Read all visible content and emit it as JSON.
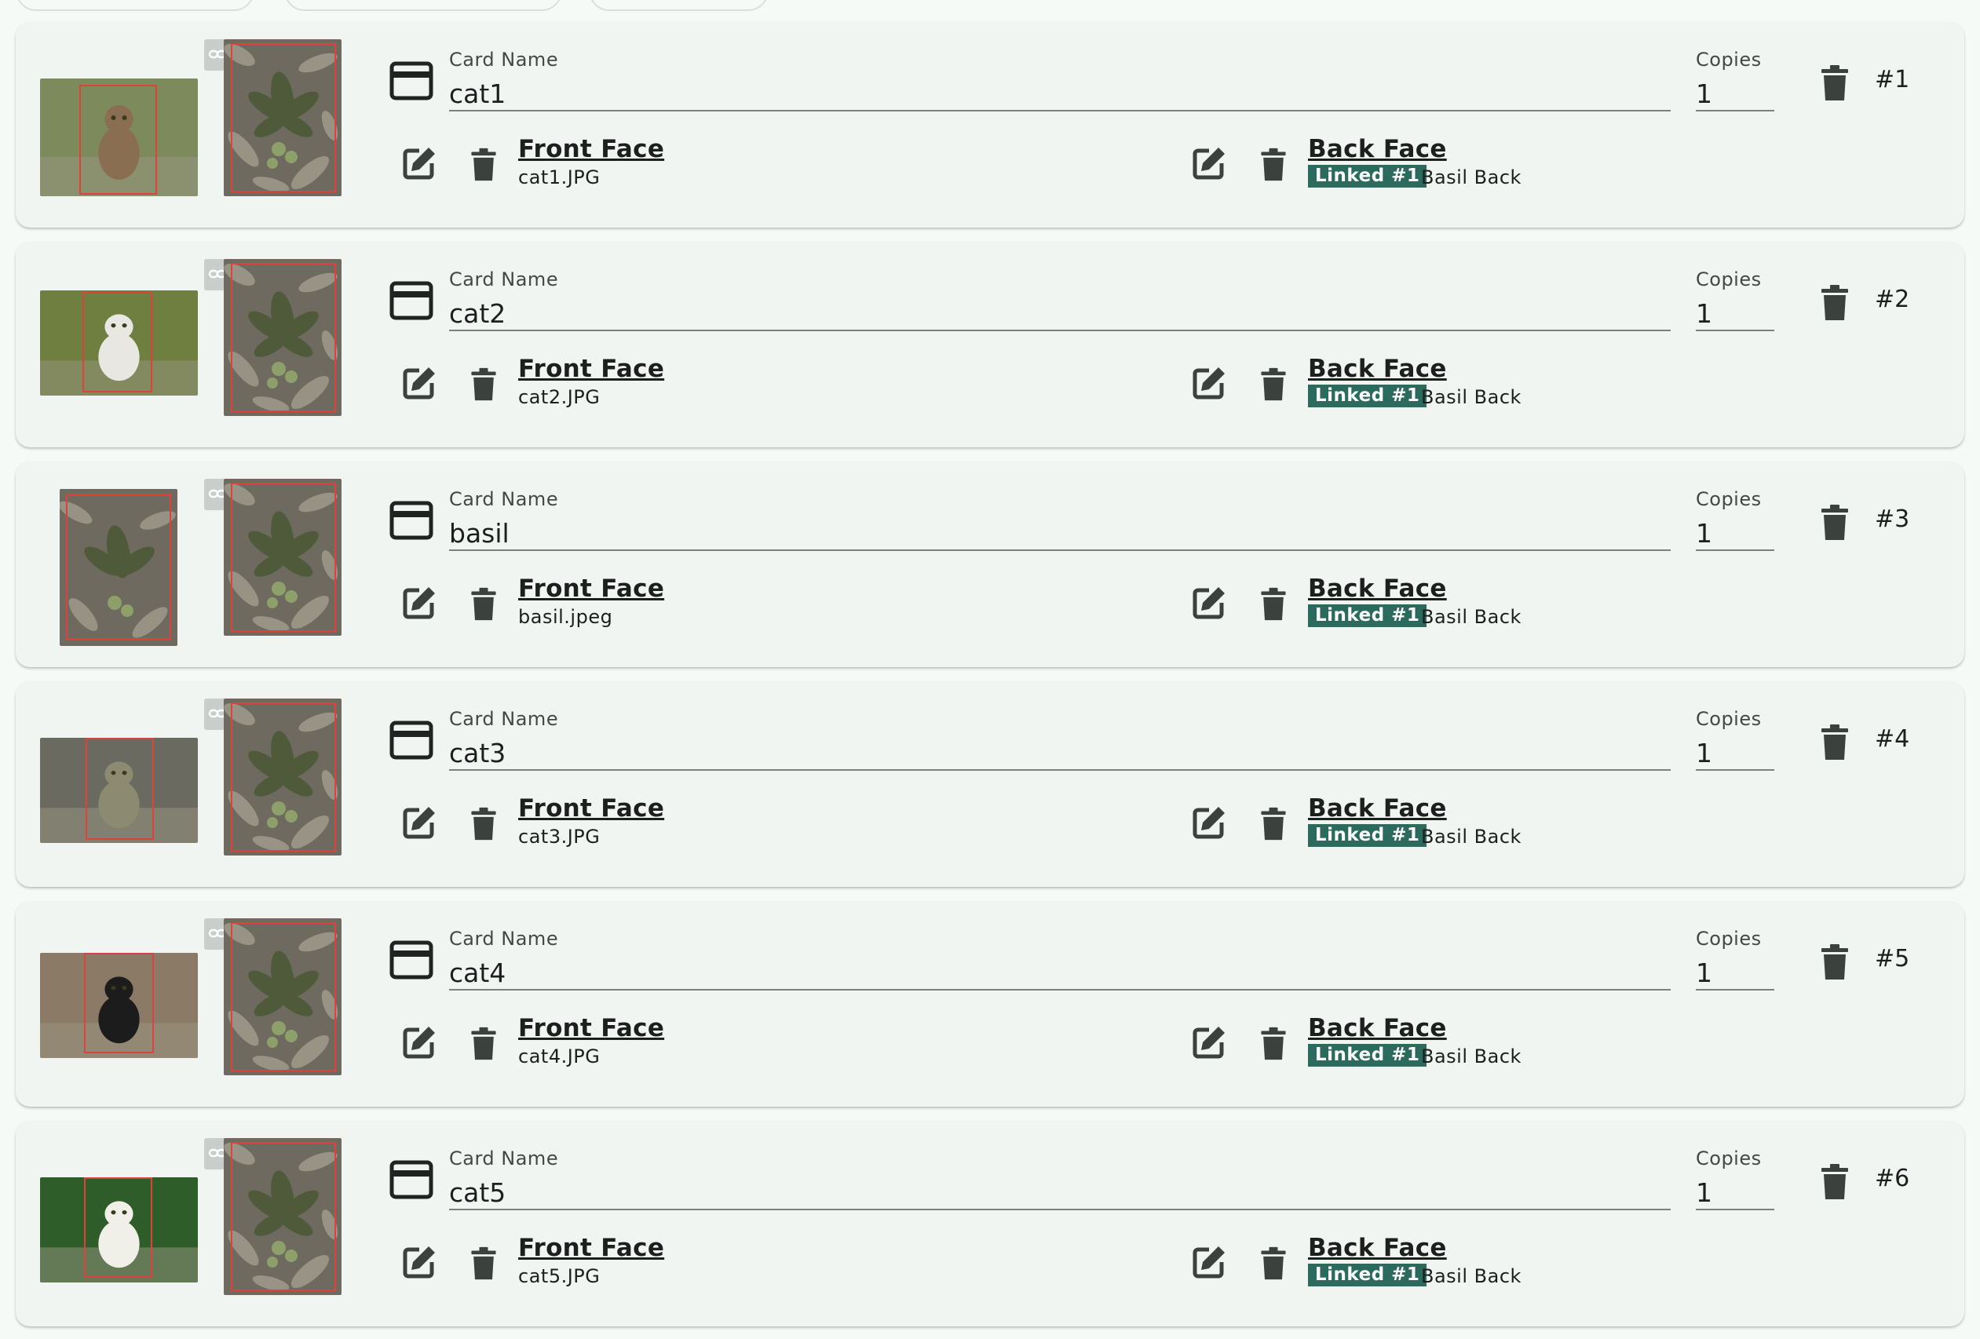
{
  "labels": {
    "card_name": "Card Name",
    "copies": "Copies",
    "front_face": "Front Face",
    "back_face": "Back Face"
  },
  "colors": {
    "linked_badge": "#2a6b5e",
    "crop_box": "#e0413b",
    "card_bg": "#f1f5f2",
    "icon": "#3b413d"
  },
  "icons": [
    "card-icon",
    "edit-icon",
    "trash-icon",
    "link-icon"
  ],
  "cards": [
    {
      "index": "#1",
      "name": "cat1",
      "copies": "1",
      "front_file": "cat1.JPG",
      "back_linked": "Linked #1",
      "back_name": "Basil Back"
    },
    {
      "index": "#2",
      "name": "cat2",
      "copies": "1",
      "front_file": "cat2.JPG",
      "back_linked": "Linked #1",
      "back_name": "Basil Back"
    },
    {
      "index": "#3",
      "name": "basil",
      "copies": "1",
      "front_file": "basil.jpeg",
      "back_linked": "Linked #1",
      "back_name": "Basil Back"
    },
    {
      "index": "#4",
      "name": "cat3",
      "copies": "1",
      "front_file": "cat3.JPG",
      "back_linked": "Linked #1",
      "back_name": "Basil Back"
    },
    {
      "index": "#5",
      "name": "cat4",
      "copies": "1",
      "front_file": "cat4.JPG",
      "back_linked": "Linked #1",
      "back_name": "Basil Back"
    },
    {
      "index": "#6",
      "name": "cat5",
      "copies": "1",
      "front_file": "cat5.JPG",
      "back_linked": "Linked #1",
      "back_name": "Basil Back"
    }
  ]
}
